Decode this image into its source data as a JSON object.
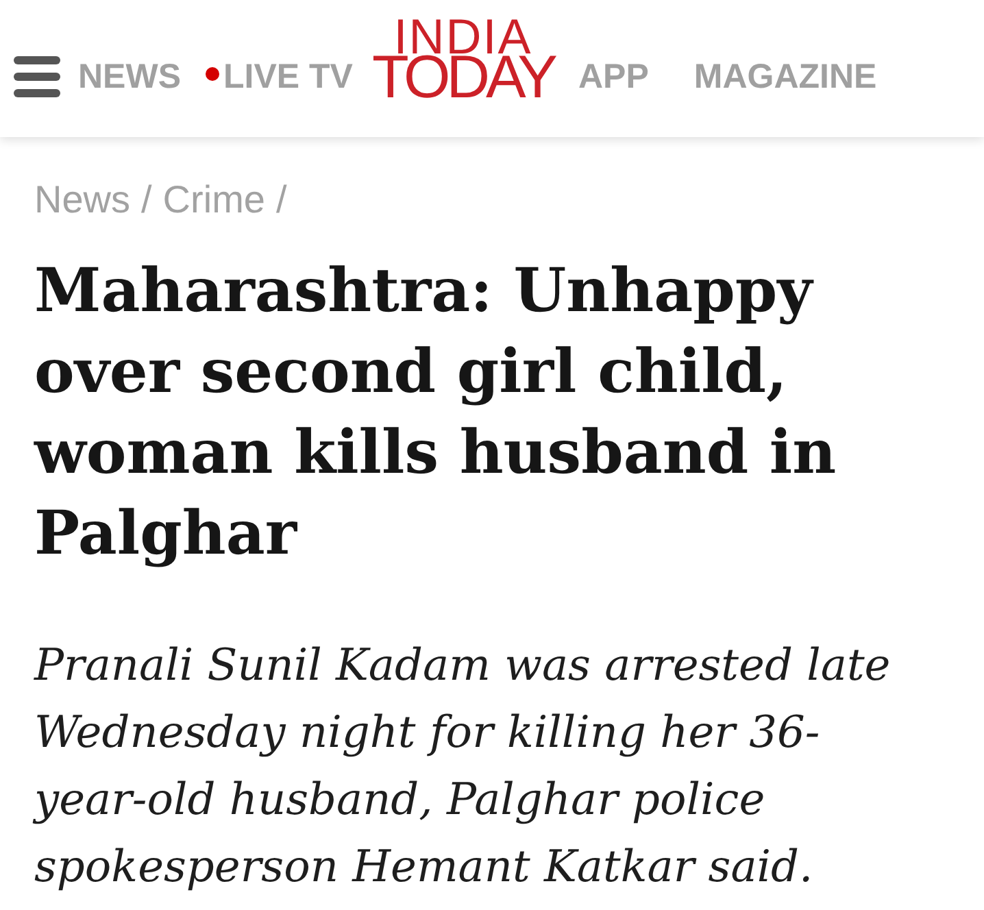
{
  "header": {
    "nav_left": [
      {
        "label": "NEWS",
        "live": false
      },
      {
        "label": "LIVE TV",
        "live": true
      }
    ],
    "logo": {
      "lines": [
        "INDIA",
        "TODAY"
      ]
    },
    "nav_right": [
      {
        "label": "APP",
        "live": false
      },
      {
        "label": "MAGAZINE",
        "live": false
      }
    ]
  },
  "article": {
    "breadcrumb": {
      "items": [
        {
          "label": "News"
        },
        {
          "label": "Crime"
        }
      ],
      "separator": "/"
    },
    "headline": "Maharashtra: Unhappy over second girl child, woman kills husband in Palghar",
    "summary": "Pranali Sunil Kadam was arrested late Wednesday night for killing her 36-year-old husband, Palghar police spokesperson Hemant Katkar said."
  }
}
